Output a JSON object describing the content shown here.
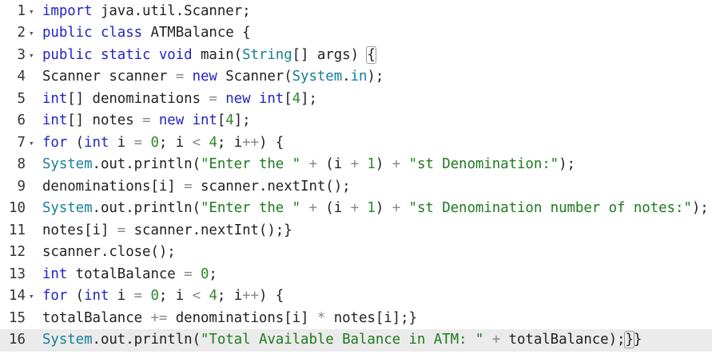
{
  "editor": {
    "lines": [
      {
        "number": "1",
        "fold": true,
        "tokens": [
          [
            "k",
            "import"
          ],
          [
            "p",
            " java.util.Scanner;"
          ]
        ]
      },
      {
        "number": "2",
        "fold": true,
        "tokens": [
          [
            "k",
            "public class"
          ],
          [
            "p",
            " ATMBalance {"
          ]
        ]
      },
      {
        "number": "3",
        "fold": true,
        "tokens": [
          [
            "k",
            "public static void"
          ],
          [
            "p",
            " main("
          ],
          [
            "t",
            "String"
          ],
          [
            "p",
            "[] args) "
          ],
          [
            "b",
            "{"
          ]
        ]
      },
      {
        "number": "4",
        "fold": false,
        "tokens": [
          [
            "p",
            "Scanner scanner "
          ],
          [
            "o",
            "="
          ],
          [
            "p",
            " "
          ],
          [
            "k",
            "new"
          ],
          [
            "p",
            " Scanner("
          ],
          [
            "t",
            "System"
          ],
          [
            "p",
            "."
          ],
          [
            "t",
            "in"
          ],
          [
            "p",
            ");"
          ]
        ]
      },
      {
        "number": "5",
        "fold": false,
        "tokens": [
          [
            "k",
            "int"
          ],
          [
            "p",
            "[] denominations "
          ],
          [
            "o",
            "="
          ],
          [
            "p",
            " "
          ],
          [
            "k",
            "new"
          ],
          [
            "p",
            " "
          ],
          [
            "k",
            "int"
          ],
          [
            "p",
            "["
          ],
          [
            "n",
            "4"
          ],
          [
            "p",
            "];"
          ]
        ]
      },
      {
        "number": "6",
        "fold": false,
        "tokens": [
          [
            "k",
            "int"
          ],
          [
            "p",
            "[] notes "
          ],
          [
            "o",
            "="
          ],
          [
            "p",
            " "
          ],
          [
            "k",
            "new"
          ],
          [
            "p",
            " "
          ],
          [
            "k",
            "int"
          ],
          [
            "p",
            "["
          ],
          [
            "n",
            "4"
          ],
          [
            "p",
            "];"
          ]
        ]
      },
      {
        "number": "7",
        "fold": true,
        "tokens": [
          [
            "k",
            "for"
          ],
          [
            "p",
            " ("
          ],
          [
            "k",
            "int"
          ],
          [
            "p",
            " i "
          ],
          [
            "o",
            "="
          ],
          [
            "p",
            " "
          ],
          [
            "n",
            "0"
          ],
          [
            "p",
            "; i "
          ],
          [
            "o",
            "<"
          ],
          [
            "p",
            " "
          ],
          [
            "n",
            "4"
          ],
          [
            "p",
            "; i"
          ],
          [
            "o",
            "++"
          ],
          [
            "p",
            ") {"
          ]
        ]
      },
      {
        "number": "8",
        "fold": false,
        "tokens": [
          [
            "t",
            "System"
          ],
          [
            "p",
            ".out.println("
          ],
          [
            "s",
            "\"Enter the \""
          ],
          [
            "p",
            " "
          ],
          [
            "o",
            "+"
          ],
          [
            "p",
            " (i "
          ],
          [
            "o",
            "+"
          ],
          [
            "p",
            " "
          ],
          [
            "n",
            "1"
          ],
          [
            "p",
            ") "
          ],
          [
            "o",
            "+"
          ],
          [
            "p",
            " "
          ],
          [
            "s",
            "\"st Denomination:\""
          ],
          [
            "p",
            ");"
          ]
        ]
      },
      {
        "number": "9",
        "fold": false,
        "tokens": [
          [
            "p",
            "denominations[i] "
          ],
          [
            "o",
            "="
          ],
          [
            "p",
            " scanner.nextInt();"
          ]
        ]
      },
      {
        "number": "10",
        "fold": false,
        "tokens": [
          [
            "t",
            "System"
          ],
          [
            "p",
            ".out.println("
          ],
          [
            "s",
            "\"Enter the \""
          ],
          [
            "p",
            " "
          ],
          [
            "o",
            "+"
          ],
          [
            "p",
            " (i "
          ],
          [
            "o",
            "+"
          ],
          [
            "p",
            " "
          ],
          [
            "n",
            "1"
          ],
          [
            "p",
            ") "
          ],
          [
            "o",
            "+"
          ],
          [
            "p",
            " "
          ],
          [
            "s",
            "\"st Denomination number of notes:\""
          ],
          [
            "p",
            ");"
          ]
        ]
      },
      {
        "number": "11",
        "fold": false,
        "tokens": [
          [
            "p",
            "notes[i] "
          ],
          [
            "o",
            "="
          ],
          [
            "p",
            " scanner.nextInt();}"
          ]
        ]
      },
      {
        "number": "12",
        "fold": false,
        "tokens": [
          [
            "p",
            "scanner.close();"
          ]
        ]
      },
      {
        "number": "13",
        "fold": false,
        "tokens": [
          [
            "k",
            "int"
          ],
          [
            "p",
            " totalBalance "
          ],
          [
            "o",
            "="
          ],
          [
            "p",
            " "
          ],
          [
            "n",
            "0"
          ],
          [
            "p",
            ";"
          ]
        ]
      },
      {
        "number": "14",
        "fold": true,
        "tokens": [
          [
            "k",
            "for"
          ],
          [
            "p",
            " ("
          ],
          [
            "k",
            "int"
          ],
          [
            "p",
            " i "
          ],
          [
            "o",
            "="
          ],
          [
            "p",
            " "
          ],
          [
            "n",
            "0"
          ],
          [
            "p",
            "; i "
          ],
          [
            "o",
            "<"
          ],
          [
            "p",
            " "
          ],
          [
            "n",
            "4"
          ],
          [
            "p",
            "; i"
          ],
          [
            "o",
            "++"
          ],
          [
            "p",
            ") {"
          ]
        ]
      },
      {
        "number": "15",
        "fold": false,
        "tokens": [
          [
            "p",
            "totalBalance "
          ],
          [
            "o",
            "+="
          ],
          [
            "p",
            " denominations[i] "
          ],
          [
            "o",
            "*"
          ],
          [
            "p",
            " notes[i];}"
          ]
        ]
      },
      {
        "number": "16",
        "fold": false,
        "active": true,
        "tokens": [
          [
            "t",
            "System"
          ],
          [
            "p",
            ".out.println("
          ],
          [
            "s",
            "\"Total Available Balance in ATM: \""
          ],
          [
            "p",
            " "
          ],
          [
            "o",
            "+"
          ],
          [
            "p",
            " totalBalance);"
          ],
          [
            "b",
            "}"
          ],
          [
            "p",
            "}"
          ]
        ]
      }
    ],
    "fold_glyph": "▾",
    "colors": {
      "keyword": "#2323c8",
      "type": "#15809a",
      "string": "#1f7a1f",
      "number": "#2b8a2b",
      "operator": "#8a8a8a",
      "active_line_bg": "#ebebeb"
    }
  }
}
